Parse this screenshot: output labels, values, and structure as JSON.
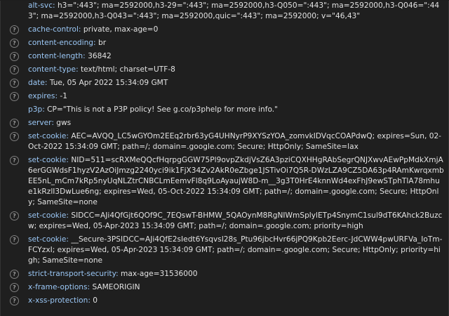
{
  "headers": [
    {
      "name": "alt-svc",
      "value": "h3=\":443\"; ma=2592000,h3-29=\":443\"; ma=2592000,h3-Q050=\":443\"; ma=2592000,h3-Q046=\":443\"; ma=2592000,h3-Q043=\":443\"; ma=2592000,quic=\":443\"; ma=2592000; v=\"46,43\"",
      "help": false
    },
    {
      "name": "cache-control",
      "value": "private, max-age=0",
      "help": true
    },
    {
      "name": "content-encoding",
      "value": "br",
      "help": true
    },
    {
      "name": "content-length",
      "value": "36842",
      "help": true
    },
    {
      "name": "content-type",
      "value": "text/html; charset=UTF-8",
      "help": true
    },
    {
      "name": "date",
      "value": "Tue, 05 Apr 2022 15:34:09 GMT",
      "help": true
    },
    {
      "name": "expires",
      "value": "-1",
      "help": true
    },
    {
      "name": "p3p",
      "value": "CP=\"This is not a P3P policy! See g.co/p3phelp for more info.\"",
      "help": false
    },
    {
      "name": "server",
      "value": "gws",
      "help": true
    },
    {
      "name": "set-cookie",
      "value": "AEC=AVQQ_LC5wGYOm2EEq2rbr63yG4UHNyrP9XYSzYOA_zomvkIDVqcCOAPdwQ; expires=Sun, 02-Oct-2022 15:34:09 GMT; path=/; domain=.google.com; Secure; HttpOnly; SameSite=lax",
      "help": true
    },
    {
      "name": "set-cookie",
      "value": "NID=511=scRXMeQQcfHqrpgGGW75Pl9ovpZkdjVsZ6A3pziCQXHHgRAbSegrQNJXwvAEwPpMdkXmjA6erGGWdsF1hyzV2AzOiJmzg2240yci9ik1FjX34Zv2AkR0eZbge1JSTivOi7Q5R-DWzLZA9CZ5DA63p4RAmKwrqxmbEE5nL_mCm7kRp5nyUqNLZtrCNBCLmEemvFl8q9LoAyaujW8D-m__3g3T0HrE4knnWd4exFhJ9ewSTphTlA78mhue1kRzlI3DwLue6ng; expires=Wed, 05-Oct-2022 15:34:09 GMT; path=/; domain=.google.com; Secure; HttpOnly; SameSite=none",
      "help": true
    },
    {
      "name": "set-cookie",
      "value": "SIDCC=AJi4QfGjt6QOf9C_7EQswT-BHMW_5QAOynM8RgNIWmSplylETp4SnymC1sul9dT6KAhck2Buzcw; expires=Wed, 05-Apr-2023 15:34:09 GMT; path=/; domain=.google.com; priority=high",
      "help": true
    },
    {
      "name": "set-cookie",
      "value": "__Secure-3PSIDCC=AJi4QfE2sIedt6Ysqvsl28s_Ptu96jbcHvr66jPQ9Kpb2Eerc-JdCWW4pwURFVa_IoTm-FCYzxI; expires=Wed, 05-Apr-2023 15:34:09 GMT; path=/; domain=.google.com; Secure; HttpOnly; priority=high; SameSite=none",
      "help": true
    },
    {
      "name": "strict-transport-security",
      "value": "max-age=31536000",
      "help": true
    },
    {
      "name": "x-frame-options",
      "value": "SAMEORIGIN",
      "help": true
    },
    {
      "name": "x-xss-protection",
      "value": "0",
      "help": true
    }
  ],
  "icons": {
    "help_glyph": "?",
    "help_icon_name": "help-circle-icon"
  },
  "colors": {
    "background": "#1f1f1f",
    "header_name": "#9bc7f5",
    "header_value": "#e2e2e2",
    "icon": "#7f7f7f"
  }
}
